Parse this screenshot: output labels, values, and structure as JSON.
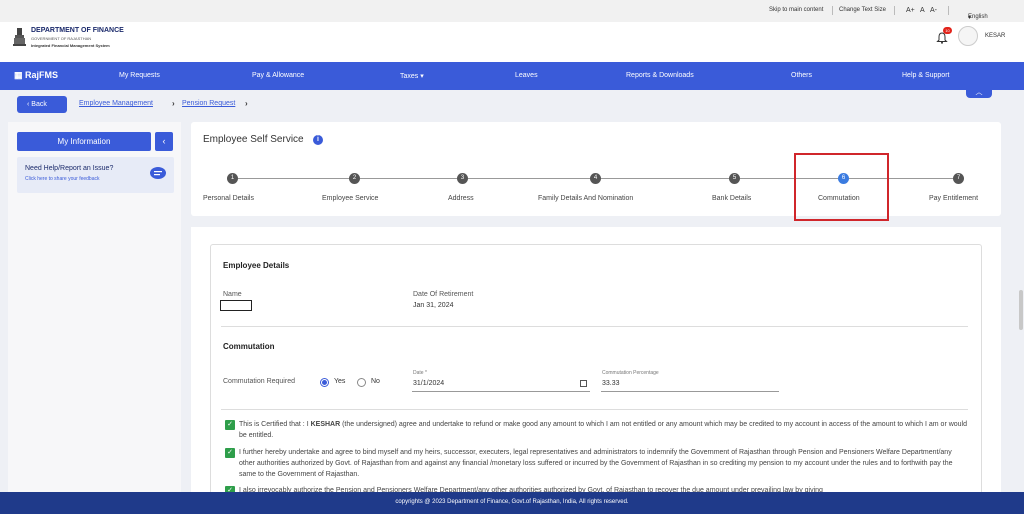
{
  "utility": {
    "skip": "Skip to main content",
    "change_text_size": "Change Text Size",
    "text_sizes": [
      "A+",
      "A",
      "A-"
    ],
    "language": "English"
  },
  "header": {
    "dept_title": "DEPARTMENT OF FINANCE",
    "dept_sub": "GOVERNMENT OF RAJASTHAN",
    "system_name": "Integrated Financial Management System",
    "notification_count": "10",
    "user_name": "KESAR"
  },
  "nav": {
    "logo": "RajFMS",
    "items": [
      "My Requests",
      "Pay & Allowance",
      "Taxes",
      "Leaves",
      "Reports & Downloads",
      "Others",
      "Help & Support"
    ]
  },
  "breadcrumb": {
    "back": "Back",
    "items": [
      "Employee Management",
      "Pension Request"
    ]
  },
  "sidebar": {
    "my_information": "My Information",
    "help_title": "Need Help/Report an Issue?",
    "help_link": "Click here to share your feedback"
  },
  "stepper": {
    "title": "Employee Self Service",
    "steps": [
      {
        "num": "1",
        "label": "Personal Details"
      },
      {
        "num": "2",
        "label": "Employee Service"
      },
      {
        "num": "3",
        "label": "Address"
      },
      {
        "num": "4",
        "label": "Family Details And Nomination"
      },
      {
        "num": "5",
        "label": "Bank Details"
      },
      {
        "num": "6",
        "label": "Commutation"
      },
      {
        "num": "7",
        "label": "Pay Entitlement"
      }
    ],
    "active_step": 6
  },
  "employee_details": {
    "section_title": "Employee Details",
    "name_label": "Name",
    "retirement_label": "Date Of Retirement",
    "retirement_value": "Jan 31, 2024"
  },
  "commutation": {
    "section_title": "Commutation",
    "required_label": "Commutation Required",
    "yes": "Yes",
    "no": "No",
    "date_label": "Date *",
    "date_value": "31/1/2024",
    "percentage_label": "Commutation Percentage",
    "percentage_value": "33.33"
  },
  "declarations": [
    {
      "pre": "This is Certified that : I ",
      "name": "KESHAR",
      "post": " (the undersigned) agree and undertake to refund or make good any amount to which I am not entitled or any amount which may be credited to my account in access of the amount to which I am or would be entitled."
    },
    {
      "text": "I further hereby undertake and agree to bind myself and my heirs, successor, executers, legal representatives and administrators to indemnify the Government of Rajasthan through Pension and Pensioners Welfare Department/any other authorities authorized by Govt. of Rajasthan from and against any financial /monetary loss suffered or incurred by the Government of Rajasthan in so crediting my pension to my account under the rules and to forthwith pay the same to the Government of Rajasthan."
    },
    {
      "text": "I also irrevocably authorize the Pension and Pensioners Welfare Department/any other authorities authorized by Govt. of Rajasthan to recover the due amount under prevailing law by giving"
    }
  ],
  "footer": {
    "text": "copyrights @ 2023 Department of Finance, Govt.of Rajasthan, India, All rights reserved."
  },
  "colors": {
    "primary": "#3a5bd9",
    "footer": "#1f3a8a",
    "highlight": "#d0262b",
    "check": "#2e9e4a"
  }
}
